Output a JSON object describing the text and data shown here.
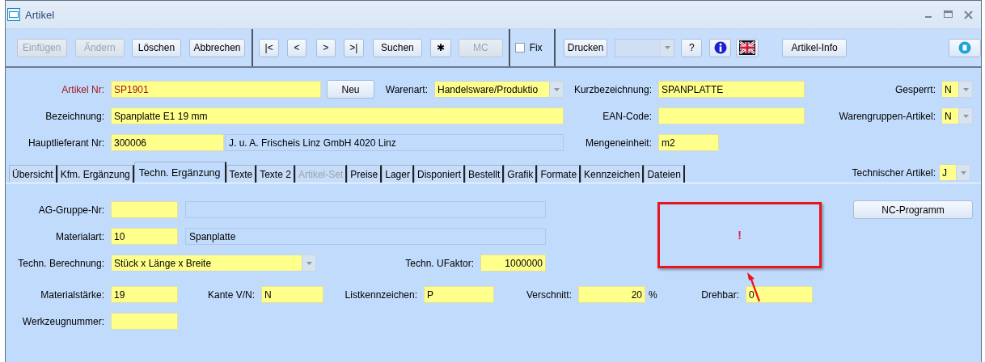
{
  "window": {
    "title": "Artikel"
  },
  "toolbar": [
    {
      "kind": "button",
      "label": "Einfügen",
      "disabled": true
    },
    {
      "kind": "button",
      "label": "Ändern",
      "disabled": true
    },
    {
      "kind": "button",
      "label": "Löschen",
      "disabled": false
    },
    {
      "kind": "button",
      "label": "Abbrechen",
      "disabled": false
    },
    {
      "kind": "separator"
    },
    {
      "kind": "button",
      "label": "|<",
      "disabled": false
    },
    {
      "kind": "button",
      "label": "<",
      "disabled": false
    },
    {
      "kind": "button",
      "label": ">",
      "disabled": false
    },
    {
      "kind": "button",
      "label": ">|",
      "disabled": false
    },
    {
      "kind": "button",
      "label": "Suchen",
      "disabled": false
    },
    {
      "kind": "button",
      "label": "✱",
      "disabled": false
    },
    {
      "kind": "button",
      "label": "MC",
      "disabled": true
    },
    {
      "kind": "separator"
    },
    {
      "kind": "checkbox",
      "label": "Fix",
      "checked": false
    },
    {
      "kind": "separator"
    },
    {
      "kind": "button",
      "label": "Drucken",
      "disabled": false
    },
    {
      "kind": "combo",
      "disabled": true
    },
    {
      "kind": "button",
      "label": "?",
      "disabled": false
    },
    {
      "kind": "info"
    },
    {
      "kind": "flag"
    },
    {
      "kind": "button",
      "label": "Artikel-Info",
      "disabled": false
    },
    {
      "kind": "round"
    }
  ],
  "header": {
    "rows": [
      {
        "items": [
          {
            "kind": "label",
            "text": "Artikel Nr:",
            "emphasis": true
          },
          {
            "kind": "field",
            "value": "SP1901",
            "emphasis": true
          },
          {
            "kind": "button",
            "label": "Neu"
          },
          {
            "kind": "label",
            "text": "Warenart:",
            "emphasis": false
          },
          {
            "kind": "combo",
            "value": "Handelsware/Produktio"
          },
          {
            "kind": "label",
            "text": "Kurzbezeichnung:",
            "emphasis": false
          },
          {
            "kind": "field",
            "value": "SPANPLATTE"
          },
          {
            "kind": "label",
            "text": "Gesperrt:",
            "emphasis": false
          },
          {
            "kind": "combo",
            "value": "N"
          }
        ]
      },
      {
        "items": [
          {
            "kind": "label",
            "text": "Bezeichnung:",
            "emphasis": false
          },
          {
            "kind": "field",
            "value": "Spanplatte E1 19 mm"
          },
          {
            "kind": "label",
            "text": "EAN-Code:",
            "emphasis": false
          },
          {
            "kind": "field",
            "value": ""
          },
          {
            "kind": "label",
            "text": "Warengruppen-Artikel:",
            "emphasis": false
          },
          {
            "kind": "combo",
            "value": "N"
          }
        ]
      },
      {
        "items": [
          {
            "kind": "label",
            "text": "Hauptlieferant Nr:",
            "emphasis": false
          },
          {
            "kind": "field",
            "value": "300006"
          },
          {
            "kind": "display",
            "value": "J. u. A. Frischeis Linz GmbH 4020 Linz"
          },
          {
            "kind": "label",
            "text": "Mengeneinheit:",
            "emphasis": false
          },
          {
            "kind": "field",
            "value": "m2"
          }
        ]
      }
    ]
  },
  "tabs": [
    {
      "label": "Übersicht",
      "selected": false,
      "disabled": false
    },
    {
      "label": "Kfm. Ergänzung",
      "selected": false,
      "disabled": false
    },
    {
      "label": "Techn. Ergänzung",
      "selected": true,
      "disabled": false
    },
    {
      "label": "Texte",
      "selected": false,
      "disabled": false
    },
    {
      "label": "Texte 2",
      "selected": false,
      "disabled": false
    },
    {
      "label": "Artikel-Set",
      "selected": false,
      "disabled": true
    },
    {
      "label": "Preise",
      "selected": false,
      "disabled": false
    },
    {
      "label": "Lager",
      "selected": false,
      "disabled": false
    },
    {
      "label": "Disponiert",
      "selected": false,
      "disabled": false
    },
    {
      "label": "Bestellt",
      "selected": false,
      "disabled": false
    },
    {
      "label": "Grafik",
      "selected": false,
      "disabled": false
    },
    {
      "label": "Formate",
      "selected": false,
      "disabled": false
    },
    {
      "label": "Kennzeichen",
      "selected": false,
      "disabled": false
    },
    {
      "label": "Dateien",
      "selected": false,
      "disabled": false
    }
  ],
  "tab_extra": {
    "label": "Technischer Artikel:",
    "value": "J"
  },
  "content": {
    "rows": [
      {
        "items": [
          {
            "kind": "label",
            "text": "AG-Gruppe-Nr:",
            "emphasis": false
          },
          {
            "kind": "field",
            "value": ""
          },
          {
            "kind": "display",
            "value": ""
          },
          {
            "kind": "button",
            "label": "NC-Programm"
          }
        ]
      },
      {
        "items": [
          {
            "kind": "label",
            "text": "Materialart:",
            "emphasis": false
          },
          {
            "kind": "field",
            "value": "10"
          },
          {
            "kind": "display",
            "value": "Spanplatte"
          }
        ]
      },
      {
        "items": [
          {
            "kind": "label",
            "text": "Techn. Berechnung:",
            "emphasis": false
          },
          {
            "kind": "combo",
            "value": "Stück x Länge x Breite"
          },
          {
            "kind": "label",
            "text": "Techn. UFaktor:",
            "emphasis": false
          },
          {
            "kind": "field",
            "value": "1000000",
            "right_aligned": true
          }
        ]
      },
      {
        "items": [
          {
            "kind": "label",
            "text": "Materialstärke:",
            "emphasis": false
          },
          {
            "kind": "field",
            "value": "19"
          },
          {
            "kind": "label",
            "text": "Kante V/N:",
            "emphasis": false
          },
          {
            "kind": "field",
            "value": "N"
          },
          {
            "kind": "label",
            "text": "Listkennzeichen:",
            "emphasis": false
          },
          {
            "kind": "field",
            "value": "P"
          },
          {
            "kind": "label",
            "text": "Verschnitt:",
            "emphasis": false
          },
          {
            "kind": "field",
            "value": "20",
            "right_aligned": true
          },
          {
            "kind": "unit",
            "text": "%"
          },
          {
            "kind": "label",
            "text": "Drehbar:",
            "emphasis": false
          },
          {
            "kind": "field",
            "value": "0"
          }
        ]
      },
      {
        "items": [
          {
            "kind": "label",
            "text": "Werkzeugnummer:",
            "emphasis": false
          },
          {
            "kind": "field",
            "value": ""
          }
        ]
      }
    ]
  },
  "annotation": {
    "mark": "!"
  }
}
